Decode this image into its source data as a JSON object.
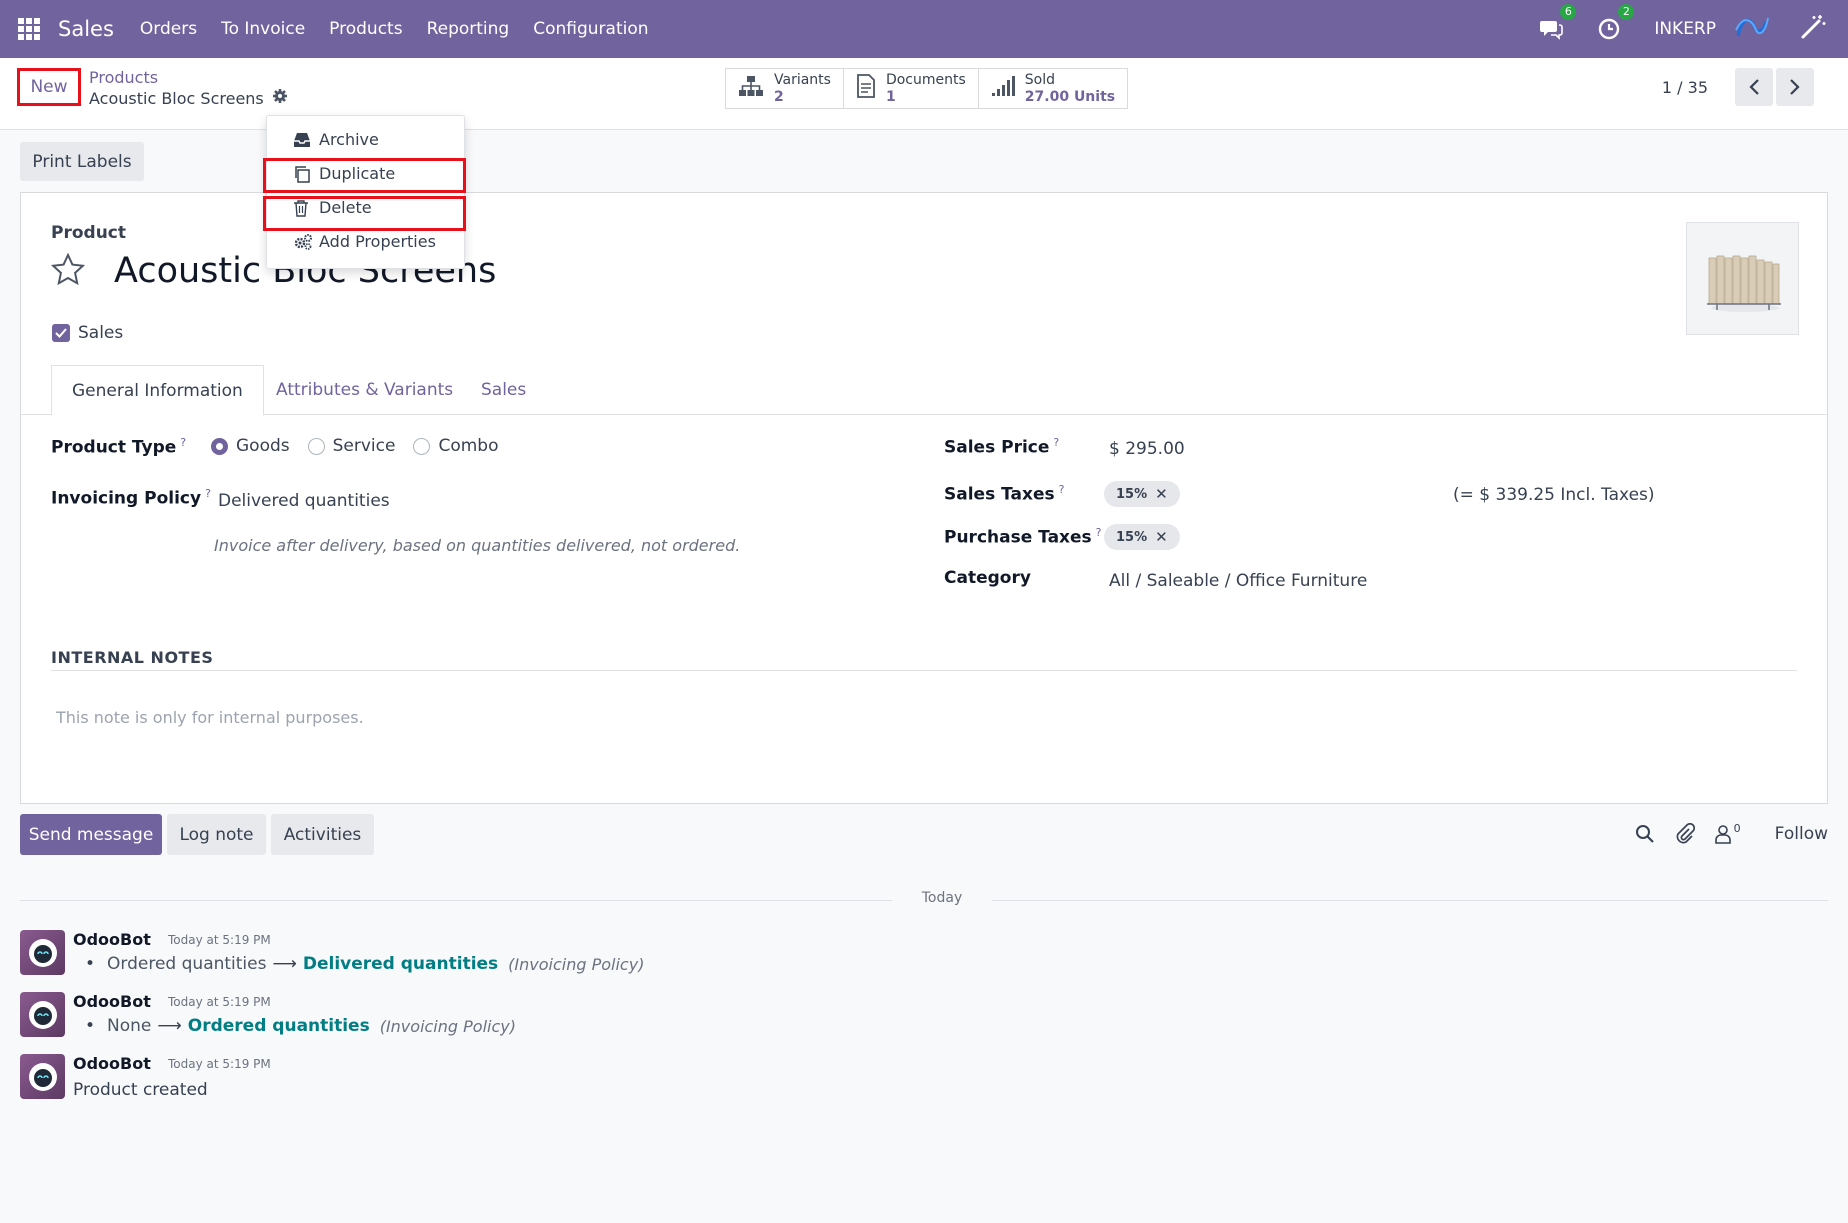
{
  "navbar": {
    "app_name": "Sales",
    "menu": [
      "Orders",
      "To Invoice",
      "Products",
      "Reporting",
      "Configuration"
    ],
    "messages_badge": "6",
    "activities_badge": "2",
    "company": "INKERP",
    "color": "#71639e"
  },
  "control": {
    "new_label": "New",
    "breadcrumb_parent": "Products",
    "breadcrumb_current": "Acoustic Bloc Screens",
    "stats": [
      {
        "label": "Variants",
        "value": "2",
        "icon": "sitemap-icon"
      },
      {
        "label": "Documents",
        "value": "1",
        "icon": "document-icon"
      },
      {
        "label": "Sold",
        "value": "27.00 Units",
        "icon": "bar-chart-icon"
      }
    ],
    "pager": "1 / 35"
  },
  "dropdown": {
    "items": [
      {
        "label": "Archive",
        "icon": "inbox-icon"
      },
      {
        "label": "Duplicate",
        "icon": "copy-icon"
      },
      {
        "label": "Delete",
        "icon": "trash-icon"
      },
      {
        "label": "Add Properties",
        "icon": "cogs-icon"
      }
    ]
  },
  "actions": {
    "print_labels": "Print Labels"
  },
  "form": {
    "product_label": "Product",
    "product_name": "Acoustic Bloc Screens",
    "sales_label": "Sales",
    "tabs": [
      "General Information",
      "Attributes & Variants",
      "Sales"
    ],
    "product_type_label": "Product Type",
    "product_type_options": [
      "Goods",
      "Service",
      "Combo"
    ],
    "product_type_selected": "Goods",
    "invoicing_policy_label": "Invoicing Policy",
    "invoicing_policy_value": "Delivered quantities",
    "invoicing_policy_help": "Invoice after delivery, based on quantities delivered, not ordered.",
    "sales_price_label": "Sales Price",
    "sales_price_value": "$ 295.00",
    "sales_taxes_label": "Sales Taxes",
    "sales_taxes_tag": "15%",
    "incl_taxes": "(= $ 339.25 Incl. Taxes)",
    "purchase_taxes_label": "Purchase Taxes",
    "purchase_taxes_tag": "15%",
    "category_label": "Category",
    "category_value": "All / Saleable / Office Furniture",
    "help_mark": "?",
    "notes_title": "INTERNAL NOTES",
    "notes_placeholder": "This note is only for internal purposes."
  },
  "chatter": {
    "send_message": "Send message",
    "log_note": "Log note",
    "activities": "Activities",
    "followers_count": "0",
    "follow": "Follow",
    "today": "Today",
    "messages": [
      {
        "author": "OdooBot",
        "date": "Today at 5:19 PM",
        "old": "Ordered quantities",
        "new": "Delivered quantities",
        "field": "(Invoicing Policy)"
      },
      {
        "author": "OdooBot",
        "date": "Today at 5:19 PM",
        "old": "None",
        "new": "Ordered quantities",
        "field": "(Invoicing Policy)"
      },
      {
        "author": "OdooBot",
        "date": "Today at 5:19 PM",
        "text": "Product created"
      }
    ]
  }
}
